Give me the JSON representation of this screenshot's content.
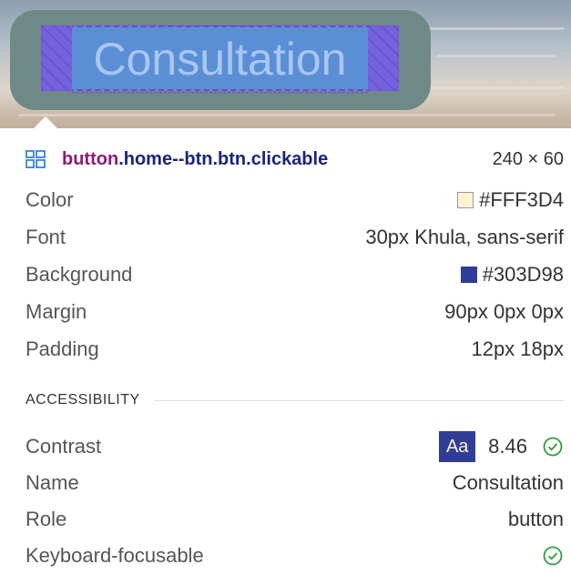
{
  "preview": {
    "button_text": "Consultation"
  },
  "inspector": {
    "selector_tag": "button",
    "selector_classes": ".home--btn.btn.clickable",
    "dimensions": "240 × 60",
    "properties": [
      {
        "label": "Color",
        "value": "#FFF3D4",
        "swatch": "#FFF3D4"
      },
      {
        "label": "Font",
        "value": "30px Khula, sans-serif"
      },
      {
        "label": "Background",
        "value": "#303D98",
        "swatch": "#303D98"
      },
      {
        "label": "Margin",
        "value": "90px 0px 0px"
      },
      {
        "label": "Padding",
        "value": "12px 18px"
      }
    ],
    "accessibility": {
      "title": "ACCESSIBILITY",
      "contrast_label": "Contrast",
      "contrast_sample": "Aa",
      "contrast_value": "8.46",
      "name_label": "Name",
      "name_value": "Consultation",
      "role_label": "Role",
      "role_value": "button",
      "focusable_label": "Keyboard-focusable"
    }
  },
  "colors": {
    "accent_check": "#2e9e3e",
    "selector_tag": "#8b1a7a"
  },
  "icons": {
    "element": "element-layout-icon",
    "check": "check-circle-icon"
  }
}
